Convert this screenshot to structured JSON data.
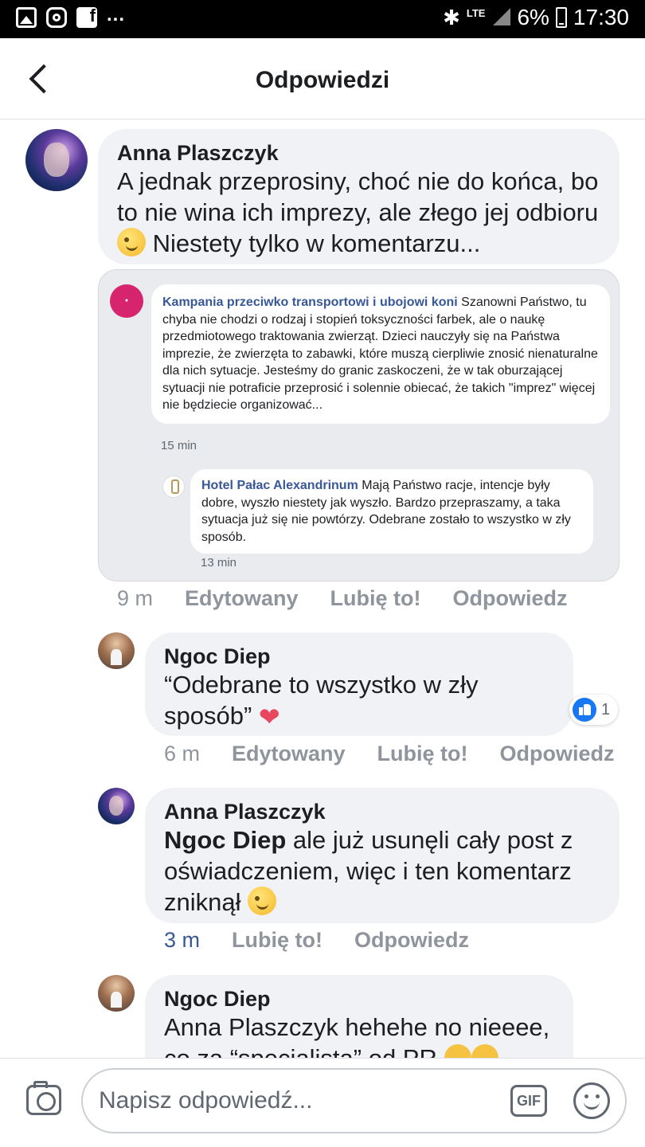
{
  "status_bar": {
    "lte": "LTE",
    "battery": "6%",
    "time": "17:30",
    "more": "..."
  },
  "header": {
    "title": "Odpowiedzi"
  },
  "comment1": {
    "author": "Anna Plaszczyk",
    "text_line_a": "A jednak przeprosiny, choć nie do końca, bo to nie wina ich imprezy, ale złego jej odbioru",
    "text_line_b": " Niestety tylko w komentarzu...",
    "time": "9 m",
    "edited": "Edytowany",
    "like": "Lubię to!",
    "reply": "Odpowiedz",
    "embed": {
      "post1_author": "Kampania przeciwko transportowi i ubojowi koni",
      "post1_text": " Szanowni Państwo, tu chyba nie chodzi o rodzaj i stopień toksyczności farbek, ale o naukę przedmiotowego traktowania zwierząt. Dzieci nauczyły się na Państwa imprezie, że zwierzęta to zabawki, które muszą cierpliwie znosić nienaturalne dla nich sytuacje. Jesteśmy do granic zaskoczeni, że w tak oburzającej sytuacji nie potraficie przeprosić i solennie obiecać, że takich \"imprez\" więcej nie będziecie organizować...",
      "post1_time": "15 min",
      "post2_author": "Hotel Pałac Alexandrinum",
      "post2_text": " Mają Państwo racje, intencje były dobre, wyszło niestety jak wyszło. Bardzo przepraszamy, a taka sytuacja już się nie powtórzy. Odebrane zostało to wszystko w zły sposób.",
      "post2_time": "13 min"
    }
  },
  "comment2": {
    "author": "Ngoc Diep",
    "text": "“Odebrane to wszystko w zły sposób”",
    "heart": "❤",
    "reaction_count": "1",
    "time": "6 m",
    "edited": "Edytowany",
    "like": "Lubię to!",
    "reply": "Odpowiedz"
  },
  "comment3": {
    "author": "Anna Plaszczyk",
    "mention": "Ngoc Diep",
    "text": " ale już usunęli cały post z oświadczeniem, więc i ten komentarz zniknął",
    "time": "3 m",
    "like": "Lubię to!",
    "reply": "Odpowiedz"
  },
  "comment4": {
    "author": "Ngoc Diep",
    "text": "Anna Plaszczyk hehehe no nieeee, co za “specialista” od PR"
  },
  "compose": {
    "placeholder": "Napisz odpowiedź...",
    "gif_label": "GIF"
  },
  "icons": {
    "back": "back-arrow-icon",
    "camera": "camera-icon",
    "emoji": "smiley-icon",
    "like": "thumbs-up-icon"
  },
  "colors": {
    "bubble_bg": "#f0f2f5",
    "link": "#385898",
    "muted": "#90949c",
    "like_blue": "#1877f2"
  }
}
